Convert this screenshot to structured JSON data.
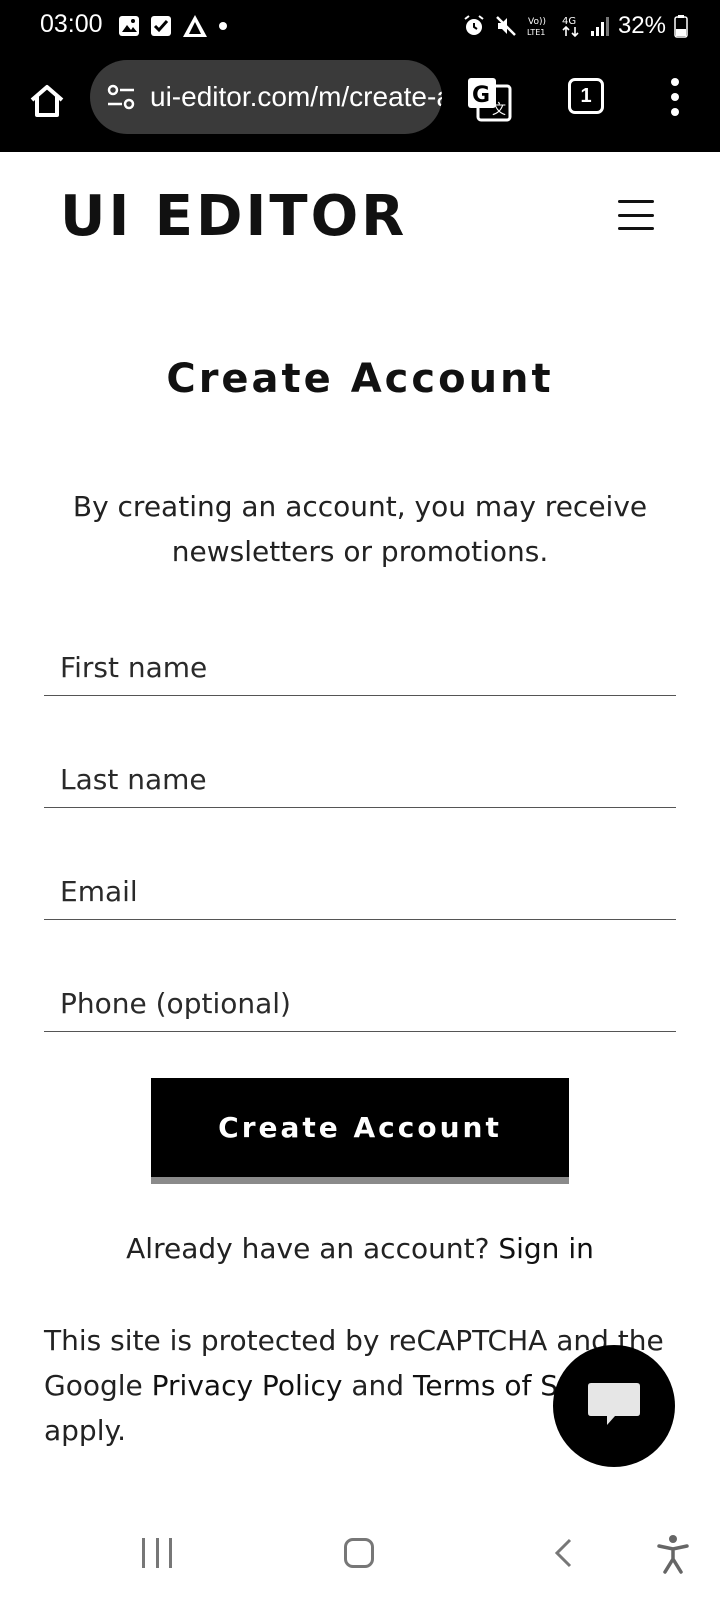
{
  "status_bar": {
    "time": "03:00",
    "battery": "32%",
    "network": "4G",
    "volte": "Vo)) LTE1"
  },
  "browser": {
    "url": "ui-editor.com/m/create-account",
    "tab_count": "1"
  },
  "site": {
    "logo": "UI EDITOR"
  },
  "page": {
    "title": "Create Account",
    "intro": "By creating an account, you may receive newsletters or promotions."
  },
  "form": {
    "first_name_placeholder": "First name",
    "last_name_placeholder": "Last name",
    "email_placeholder": "Email",
    "phone_placeholder": "Phone (optional)",
    "submit_label": "Create Account"
  },
  "signin": {
    "prompt": "Already have an account?",
    "link": "Sign in"
  },
  "recaptcha": {
    "prefix": "This site is protected by reCAPTCHA and the Google",
    "privacy_link": "Privacy Policy",
    "middle": "and",
    "terms_link": "Terms of Service",
    "suffix": "apply."
  }
}
